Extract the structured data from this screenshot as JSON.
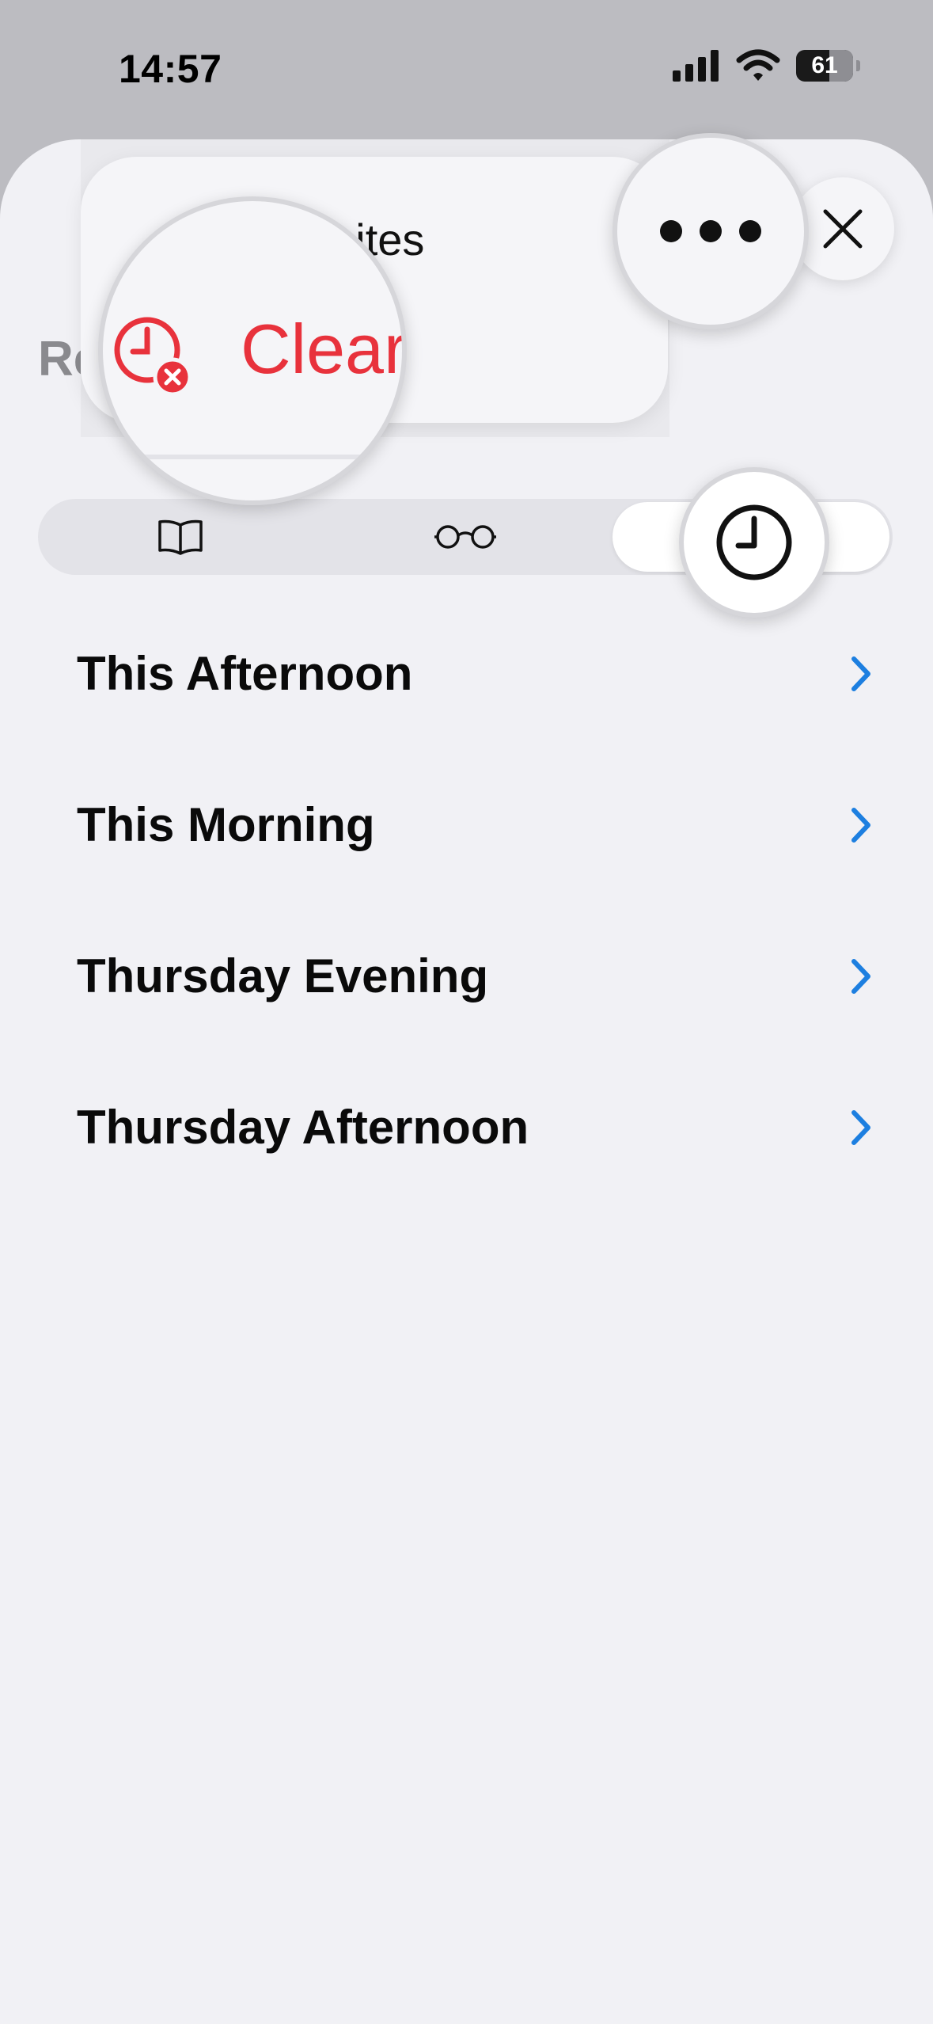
{
  "status_bar": {
    "time": "14:57",
    "battery": "61"
  },
  "sheet": {
    "title_fragment": "Re"
  },
  "menu": {
    "item_label": "Clear Recent Websites",
    "item_label_visible": "t Websites",
    "clear_label": "Clear"
  },
  "segments": [
    {
      "icon": "book-icon",
      "label": "Bookmarks"
    },
    {
      "icon": "glasses-icon",
      "label": "Reading List"
    },
    {
      "icon": "clock-icon",
      "label": "History",
      "selected": true
    }
  ],
  "history": [
    {
      "label": "This Afternoon"
    },
    {
      "label": "This Morning"
    },
    {
      "label": "Thursday Evening"
    },
    {
      "label": "Thursday Afternoon"
    }
  ],
  "colors": {
    "accent": "#1d7fe0",
    "destructive": "#e8323c",
    "background": "#f1f1f5"
  }
}
